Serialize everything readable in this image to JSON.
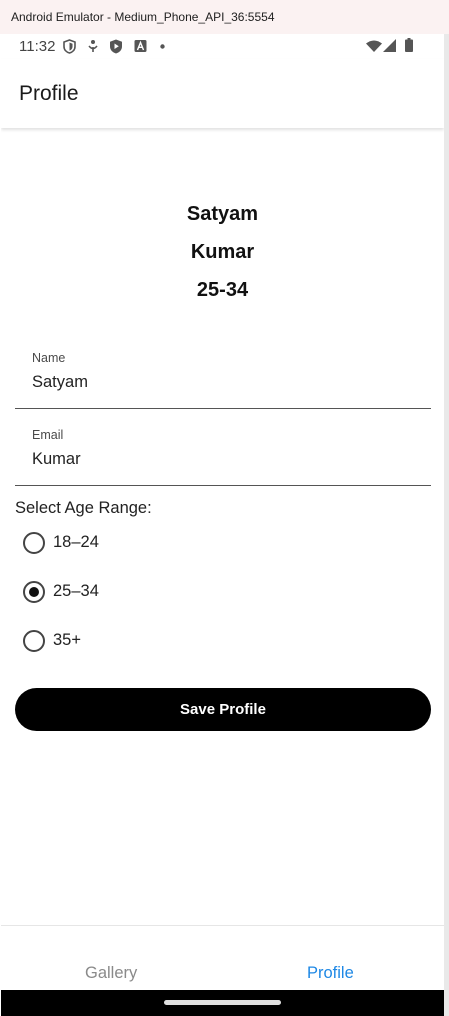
{
  "window": {
    "title": "Android Emulator - Medium_Phone_API_36:5554"
  },
  "status_bar": {
    "time": "11:32"
  },
  "app_bar": {
    "title": "Profile"
  },
  "summary": {
    "name": "Satyam",
    "email": "Kumar",
    "age": "25-34"
  },
  "form": {
    "name_label": "Name",
    "name_value": "Satyam",
    "email_label": "Email",
    "email_value": "Kumar",
    "age_label": "Select Age Range:",
    "age_options": [
      {
        "label": "18–24",
        "selected": false
      },
      {
        "label": "25–34",
        "selected": true
      },
      {
        "label": "35+",
        "selected": false
      }
    ],
    "save_label": "Save Profile"
  },
  "bottom_nav": {
    "tabs": [
      {
        "label": "Gallery",
        "active": false
      },
      {
        "label": "Profile",
        "active": true
      }
    ]
  },
  "colors": {
    "accent": "#1e88e5",
    "button_bg": "#000000",
    "inactive_tab": "#8a8a8a"
  }
}
